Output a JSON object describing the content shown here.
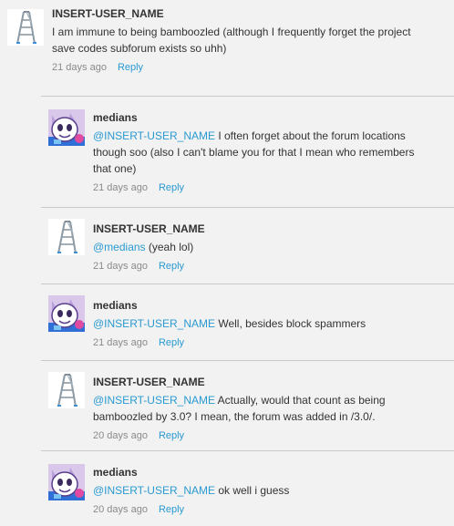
{
  "comments": [
    {
      "username": "INSERT-USER_NAME",
      "avatar": "ladder-icon",
      "mention": "",
      "text": "I am immune to being bamboozled (although I frequently forget the project save codes subforum exists so uhh)",
      "time": "21 days ago",
      "reply_label": "Reply"
    },
    {
      "username": "medians",
      "avatar": "cartoon-cat-avatar",
      "mention": "@INSERT-USER_NAME",
      "text": " I often forget about the forum locations though soo (also I can't blame you for that I mean who remembers that one)",
      "time": "21 days ago",
      "reply_label": "Reply"
    },
    {
      "username": "INSERT-USER_NAME",
      "avatar": "ladder-icon",
      "mention": "@medians",
      "text": " (yeah lol)",
      "time": "21 days ago",
      "reply_label": "Reply"
    },
    {
      "username": "medians",
      "avatar": "cartoon-cat-avatar",
      "mention": "@INSERT-USER_NAME",
      "text": " Well, besides block spammers",
      "time": "21 days ago",
      "reply_label": "Reply"
    },
    {
      "username": "INSERT-USER_NAME",
      "avatar": "ladder-icon",
      "mention": "@INSERT-USER_NAME",
      "text": " Actually, would that count as being bamboozled by 3.0? I mean, the forum was added in /3.0/.",
      "time": "20 days ago",
      "reply_label": "Reply"
    },
    {
      "username": "medians",
      "avatar": "cartoon-cat-avatar",
      "mention": "@INSERT-USER_NAME",
      "text": " ok well i guess",
      "time": "20 days ago",
      "reply_label": "Reply"
    }
  ],
  "colors": {
    "background": "#f2f2f2",
    "link": "#2a9ad1",
    "text": "#333333",
    "meta": "#8a8a8a",
    "divider": "#c9c9c9"
  }
}
